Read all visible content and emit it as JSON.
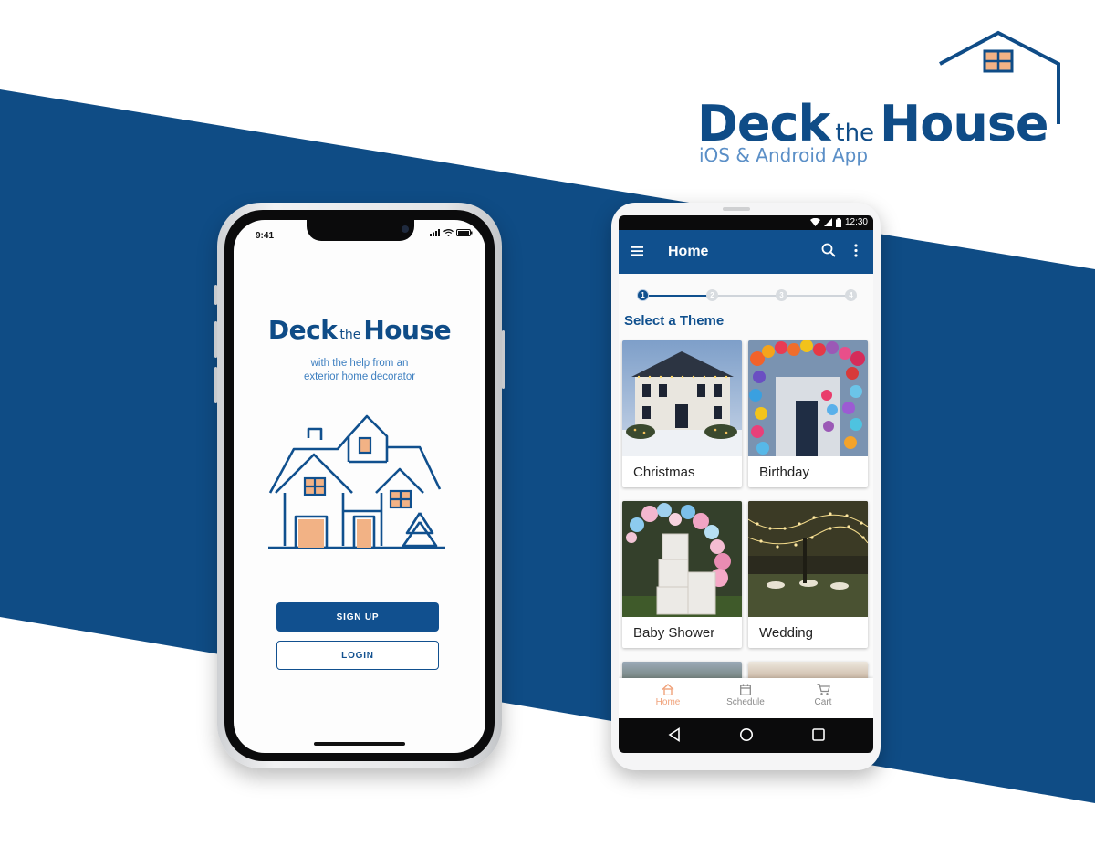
{
  "colors": {
    "brand_blue": "#10508e",
    "accent_light_blue": "#5b8fc7",
    "peach": "#f2b285",
    "background": "#ffffff"
  },
  "brand": {
    "title_big_1": "Deck",
    "title_small": "the",
    "title_big_2": "House",
    "subtitle": "iOS & Android App"
  },
  "ios": {
    "status_time": "9:41",
    "logo_big_1": "Deck",
    "logo_small": "the",
    "logo_big_2": "House",
    "tagline_line1": "with the help from an",
    "tagline_line2": "exterior home decorator",
    "signup_label": "SIGN UP",
    "login_label": "LOGIN"
  },
  "android": {
    "status_time": "12:30",
    "appbar_title": "Home",
    "stepper": {
      "steps": [
        "1",
        "2",
        "3",
        "4"
      ],
      "current": 1
    },
    "section_title": "Select a Theme",
    "themes": [
      {
        "label": "Christmas"
      },
      {
        "label": "Birthday"
      },
      {
        "label": "Baby Shower"
      },
      {
        "label": "Wedding"
      }
    ],
    "bottom_nav": [
      {
        "label": "Home",
        "icon": "home-icon",
        "active": true
      },
      {
        "label": "Schedule",
        "icon": "calendar-icon",
        "active": false
      },
      {
        "label": "Cart",
        "icon": "cart-icon",
        "active": false
      }
    ]
  }
}
